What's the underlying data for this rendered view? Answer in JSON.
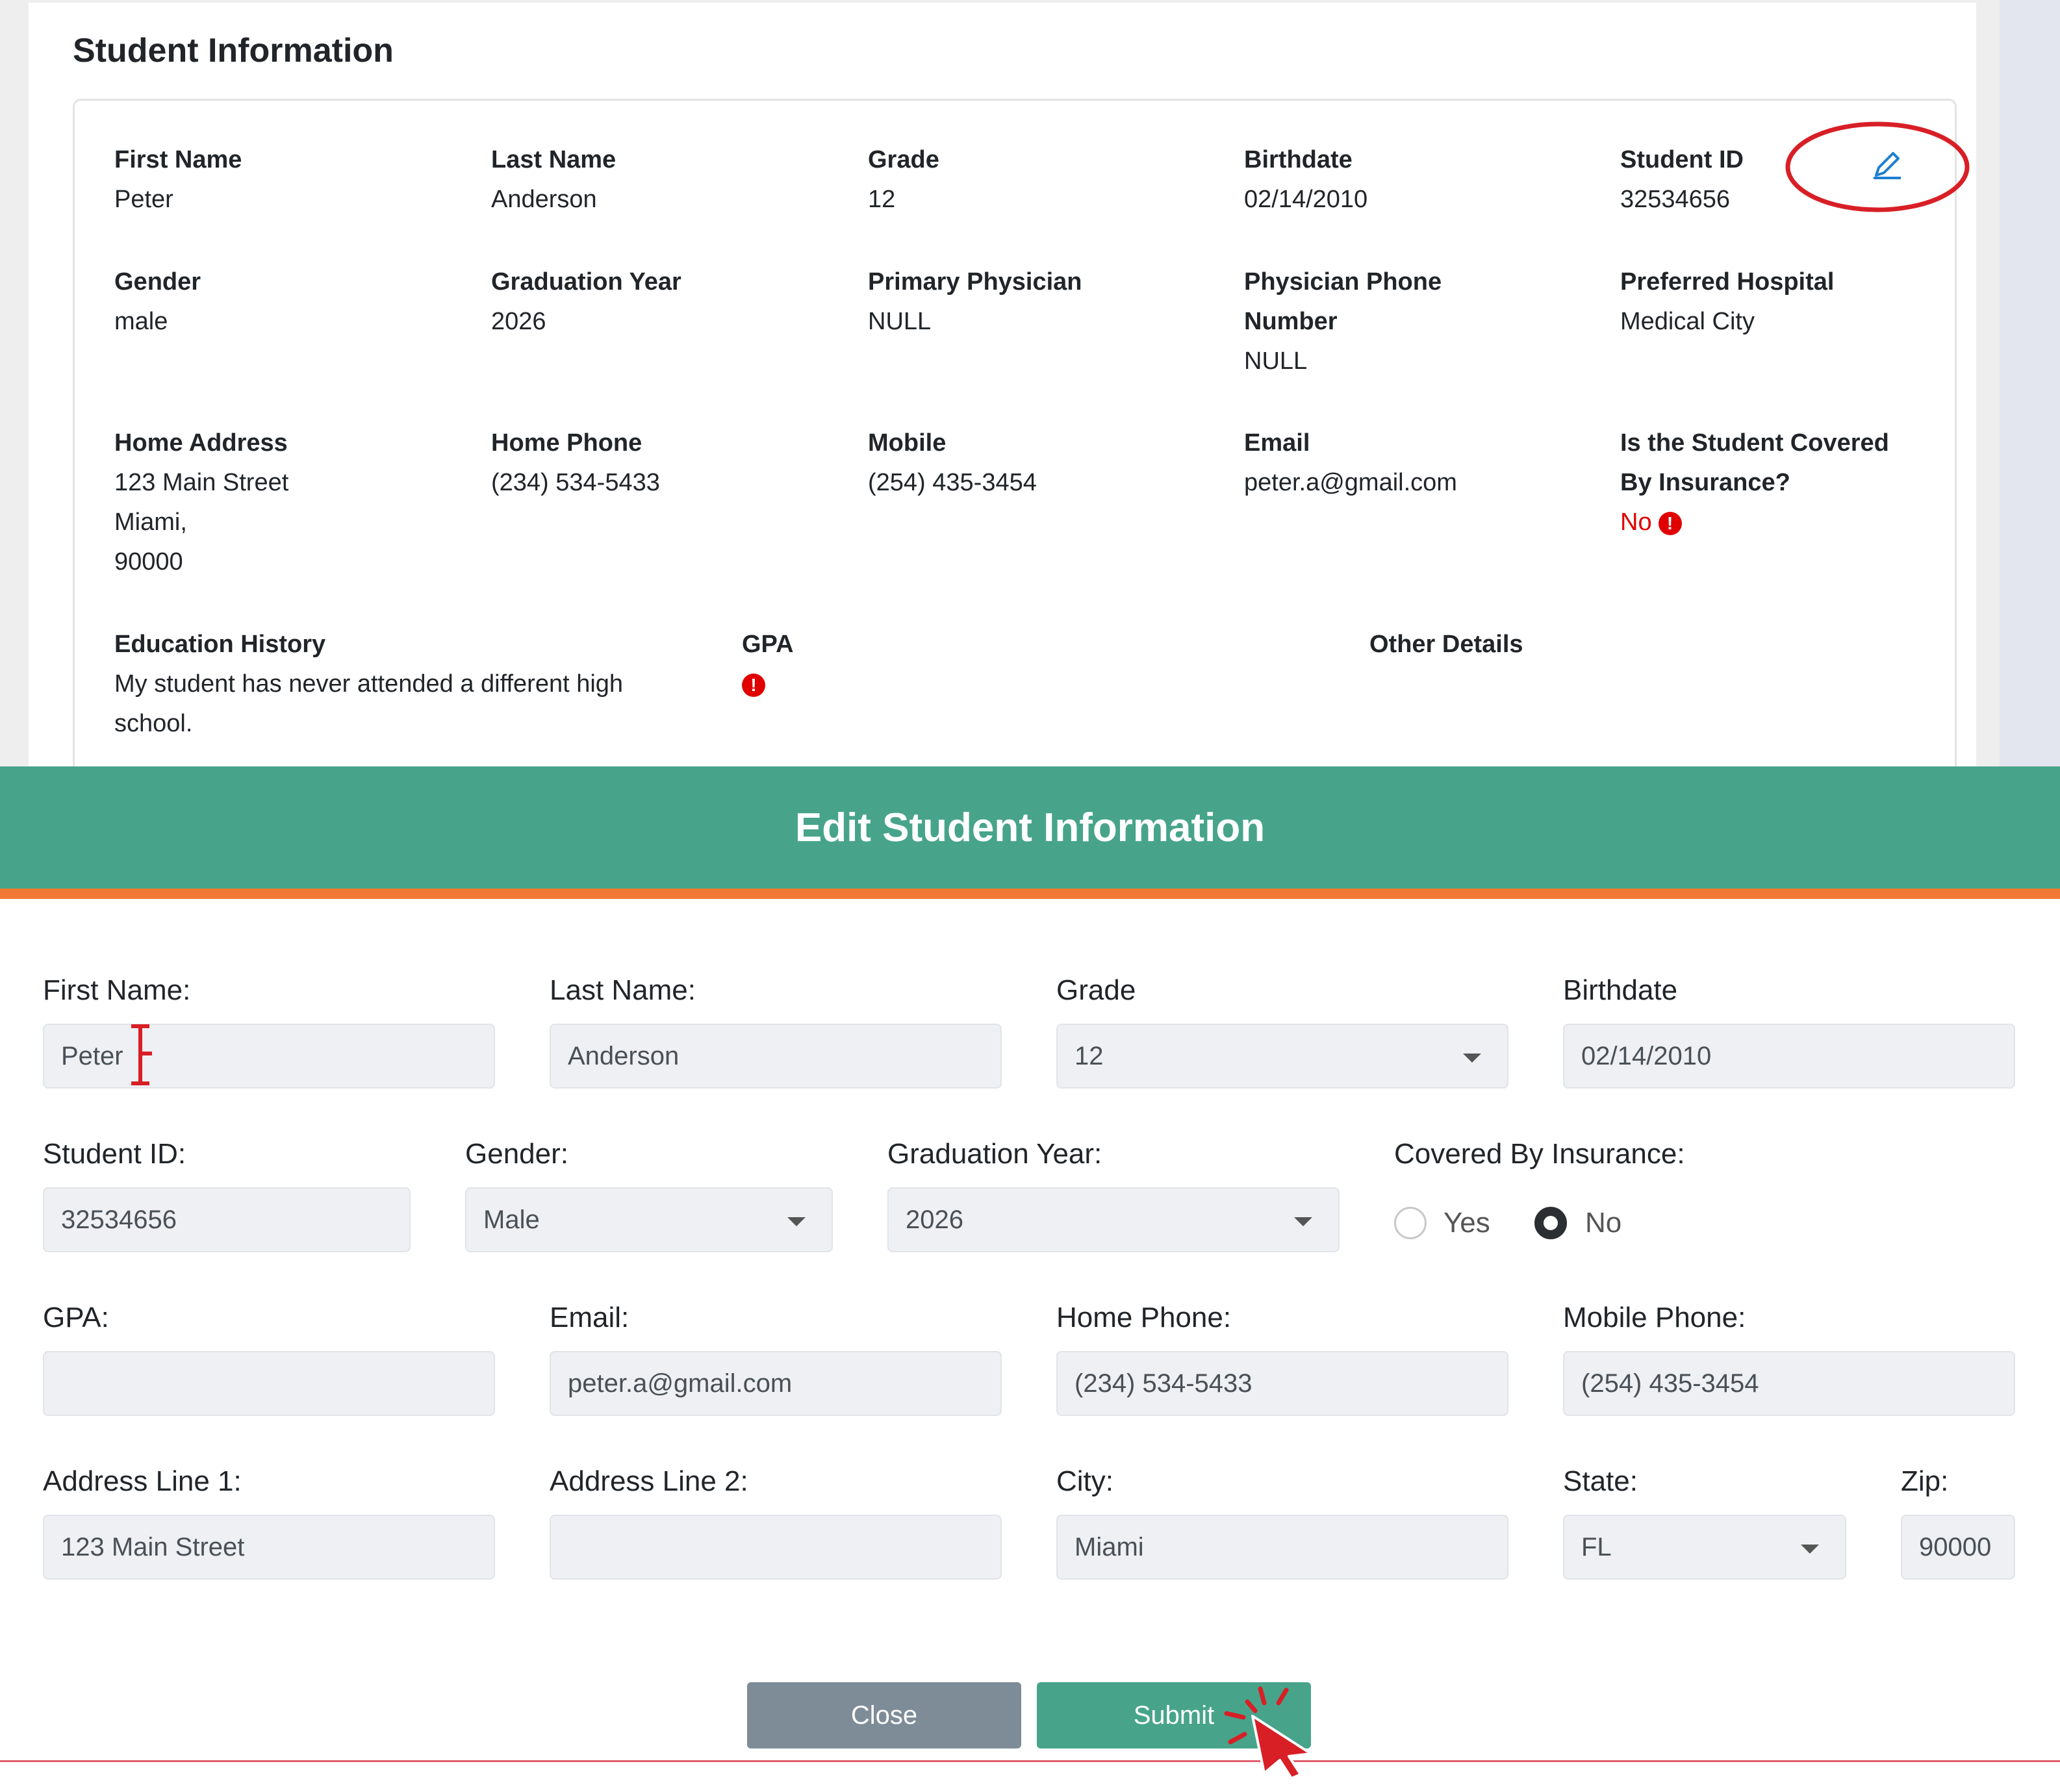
{
  "student_info": {
    "title": "Student Information",
    "fields": {
      "first_name": {
        "label": "First Name",
        "value": "Peter"
      },
      "last_name": {
        "label": "Last Name",
        "value": "Anderson"
      },
      "grade": {
        "label": "Grade",
        "value": "12"
      },
      "birthdate": {
        "label": "Birthdate",
        "value": "02/14/2010"
      },
      "student_id": {
        "label": "Student ID",
        "value": "32534656"
      },
      "gender": {
        "label": "Gender",
        "value": "male"
      },
      "graduation_year": {
        "label": "Graduation Year",
        "value": "2026"
      },
      "primary_physician": {
        "label": "Primary Physician",
        "value": "NULL"
      },
      "physician_phone": {
        "label_line1": "Physician Phone",
        "label_line2": "Number",
        "value": "NULL"
      },
      "preferred_hospital": {
        "label": "Preferred Hospital",
        "value": "Medical City"
      },
      "home_address": {
        "label": "Home Address",
        "line1": "123 Main Street",
        "line2": "Miami,",
        "line3": "90000"
      },
      "home_phone": {
        "label": "Home Phone",
        "value": "(234) 534-5433"
      },
      "mobile": {
        "label": "Mobile",
        "value": "(254) 435-3454"
      },
      "email": {
        "label": "Email",
        "value": "peter.a@gmail.com"
      },
      "insurance": {
        "label_line1": "Is the Student Covered",
        "label_line2": "By Insurance?",
        "value": "No"
      },
      "education_history": {
        "label": "Education History",
        "line1": "My student has never attended a different high",
        "line2": "school."
      },
      "gpa": {
        "label": "GPA"
      },
      "other_details": {
        "label": "Other Details"
      }
    }
  },
  "modal": {
    "title": "Edit Student Information",
    "fields": {
      "first_name": {
        "label": "First Name:",
        "value": "Peter"
      },
      "last_name": {
        "label": "Last Name:",
        "value": "Anderson"
      },
      "grade": {
        "label": "Grade",
        "value": "12"
      },
      "birthdate": {
        "label": "Birthdate",
        "value": "02/14/2010"
      },
      "student_id": {
        "label": "Student ID:",
        "value": "32534656"
      },
      "gender": {
        "label": "Gender:",
        "value": "Male"
      },
      "graduation_year": {
        "label": "Graduation Year:",
        "value": "2026"
      },
      "insurance": {
        "label": "Covered By Insurance:",
        "option_yes": "Yes",
        "option_no": "No",
        "selected": "No"
      },
      "gpa": {
        "label": "GPA:",
        "value": ""
      },
      "email": {
        "label": "Email:",
        "value": "peter.a@gmail.com"
      },
      "home_phone": {
        "label": "Home Phone:",
        "value": "(234) 534-5433"
      },
      "mobile_phone": {
        "label": "Mobile Phone:",
        "value": "(254) 435-3454"
      },
      "address1": {
        "label": "Address Line 1:",
        "value": "123 Main Street"
      },
      "address2": {
        "label": "Address Line 2:",
        "value": ""
      },
      "city": {
        "label": "City:",
        "value": "Miami"
      },
      "state": {
        "label": "State:",
        "value": "FL"
      },
      "zip": {
        "label": "Zip:",
        "value": "90000"
      }
    },
    "buttons": {
      "close": "Close",
      "submit": "Submit"
    }
  },
  "colors": {
    "header_green": "#47a48a",
    "accent_orange": "#f07a35",
    "alert_red": "#e00000",
    "edit_blue": "#1e7fd0"
  },
  "icons": [
    "edit-pencil-icon",
    "alert-icon",
    "dropdown-caret-icon",
    "text-cursor-icon",
    "click-pointer-icon"
  ]
}
